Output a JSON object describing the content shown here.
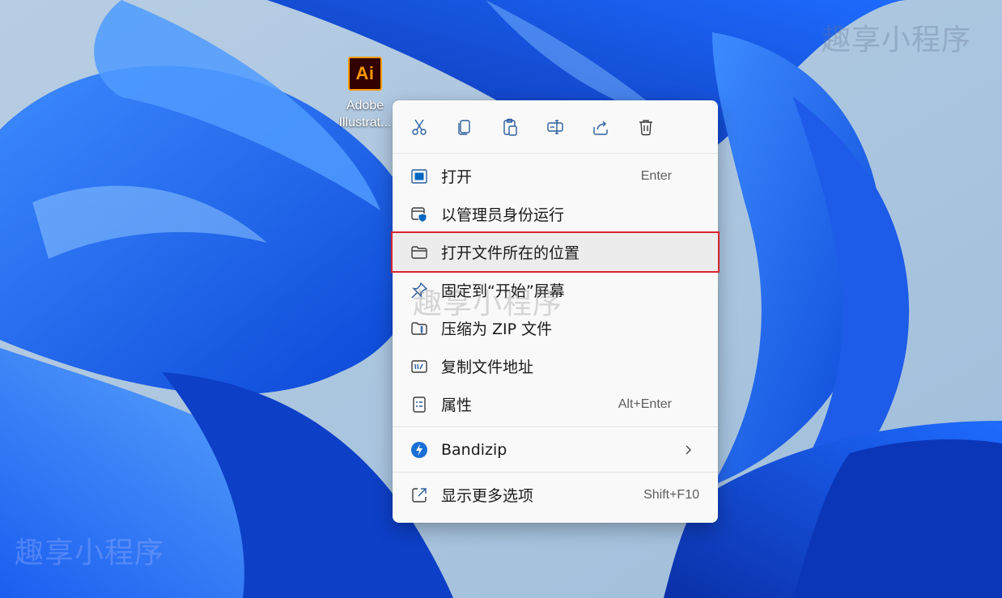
{
  "desktop": {
    "icon": {
      "logo_text": "Ai",
      "caption": "Adobe\nIllustrat..."
    }
  },
  "context_menu": {
    "quick_actions": [
      {
        "name": "cut",
        "icon": "scissors-icon"
      },
      {
        "name": "copy",
        "icon": "copy-icon"
      },
      {
        "name": "paste",
        "icon": "paste-icon"
      },
      {
        "name": "rename",
        "icon": "rename-icon"
      },
      {
        "name": "share",
        "icon": "share-icon"
      },
      {
        "name": "delete",
        "icon": "trash-icon"
      }
    ],
    "items": {
      "open": {
        "label": "打开",
        "shortcut": "Enter"
      },
      "run_as_admin": {
        "label": "以管理员身份运行"
      },
      "open_location": {
        "label": "打开文件所在的位置"
      },
      "pin_start": {
        "label": "固定到“开始”屏幕"
      },
      "compress_zip": {
        "label": "压缩为 ZIP 文件"
      },
      "copy_path": {
        "label": "复制文件地址"
      },
      "properties": {
        "label": "属性",
        "shortcut": "Alt+Enter"
      },
      "bandizip": {
        "label": "Bandizip"
      },
      "more_options": {
        "label": "显示更多选项",
        "shortcut": "Shift+F10"
      }
    }
  },
  "watermarks": {
    "top": "趣享小程序",
    "mid": "趣享小程序",
    "bottom": "趣享小程序"
  },
  "colors": {
    "highlight_border": "#d8242e",
    "accent_blue": "#0067c0",
    "ai_orange": "#ff9a00",
    "ai_bg": "#330000"
  }
}
